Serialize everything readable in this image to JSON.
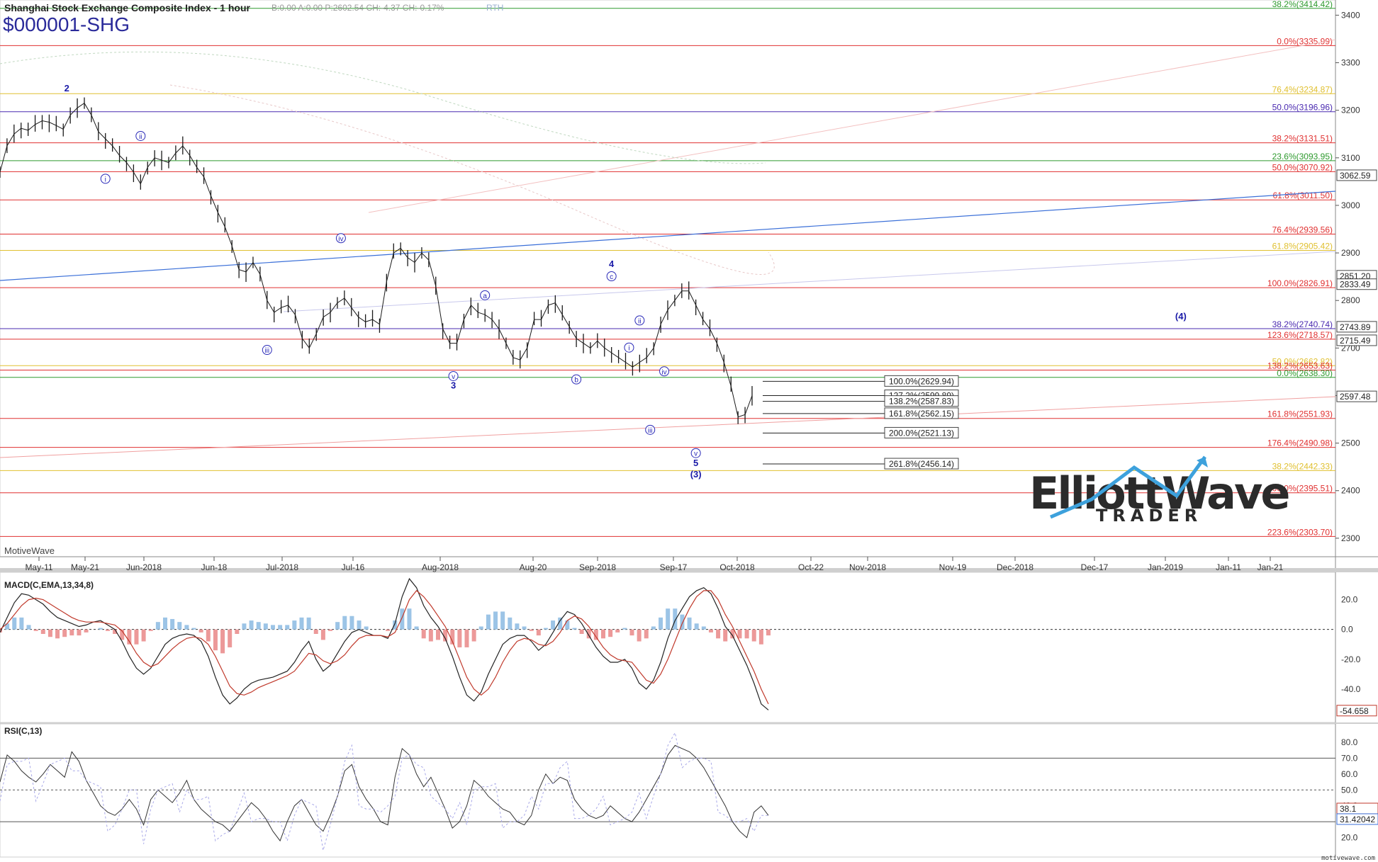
{
  "header": {
    "title": "Shanghai Stock Exchange Composite Index - 1 hour",
    "quote": "B:0.00  A:0.00  P:2602.54  CH:-4.37  CH:-0.17%",
    "rth": "RTH",
    "symbol": "$000001-SHG"
  },
  "watermark": "MotiveWave",
  "footer_brand": "motivewave.com",
  "logo": {
    "line1": "ElliottWave",
    "line2": "TRADER"
  },
  "chart_data": [
    {
      "type": "line",
      "panel": "price",
      "title": "Shanghai Stock Exchange Composite Index - 1 hour",
      "ylim": [
        2270,
        3420
      ],
      "yticks": [
        2300,
        2400,
        2500,
        2600,
        2700,
        2800,
        2900,
        3000,
        3100,
        3200,
        3300,
        3400
      ],
      "xlabels": [
        "May-11",
        "May-21",
        "Jun-2018",
        "Jun-18",
        "Jul-2018",
        "Jul-16",
        "Aug-2018",
        "Aug-20",
        "Sep-2018",
        "Sep-17",
        "Oct-2018",
        "Oct-22",
        "Nov-2018",
        "Nov-19",
        "Dec-2018",
        "Dec-17",
        "Jan-2019",
        "Jan-11",
        "Jan-21"
      ],
      "x": [
        0,
        5,
        10,
        15,
        20,
        25,
        30,
        35,
        40,
        45,
        50,
        55,
        60,
        65,
        70,
        75,
        80,
        85,
        90,
        95,
        100,
        105,
        110,
        115,
        120,
        125,
        130,
        135,
        140,
        145,
        150,
        155,
        160,
        165,
        170,
        175,
        180,
        185,
        190,
        195,
        200,
        205,
        210,
        215,
        220,
        225,
        230,
        235,
        240,
        245,
        250,
        255,
        260,
        265,
        270,
        275,
        280,
        285,
        290,
        295,
        300,
        305,
        310,
        315,
        320,
        325,
        330,
        335,
        340,
        345,
        350,
        355,
        360,
        365,
        370,
        375,
        380,
        385,
        390,
        395,
        400,
        405,
        410,
        415,
        420,
        425,
        430,
        435,
        440,
        445,
        450,
        455,
        460,
        465,
        470,
        475,
        480,
        485,
        490,
        495,
        500,
        505,
        510,
        515,
        520,
        525,
        530,
        535
      ],
      "series": [
        {
          "values": [
            3070,
            3125,
            3150,
            3162,
            3158,
            3170,
            3178,
            3175,
            3168,
            3160,
            3190,
            3205,
            3215,
            3190,
            3155,
            3140,
            3125,
            3105,
            3090,
            3070,
            3045,
            3080,
            3100,
            3095,
            3090,
            3110,
            3125,
            3105,
            3080,
            3060,
            3020,
            2985,
            2955,
            2915,
            2865,
            2860,
            2880,
            2855,
            2800,
            2775,
            2785,
            2790,
            2770,
            2720,
            2700,
            2730,
            2765,
            2775,
            2795,
            2805,
            2785,
            2765,
            2755,
            2760,
            2750,
            2840,
            2900,
            2910,
            2890,
            2880,
            2900,
            2885,
            2830,
            2740,
            2710,
            2710,
            2760,
            2790,
            2775,
            2770,
            2760,
            2740,
            2710,
            2680,
            2675,
            2700,
            2760,
            2760,
            2790,
            2795,
            2770,
            2745,
            2720,
            2710,
            2700,
            2715,
            2700,
            2690,
            2680,
            2670,
            2660,
            2670,
            2680,
            2700,
            2750,
            2780,
            2800,
            2820,
            2820,
            2790,
            2760,
            2740,
            2710,
            2670,
            2620,
            2555,
            2560,
            2600
          ]
        }
      ],
      "fib_levels": [
        {
          "label": "38.2%(3414.42)",
          "value": 3414.42,
          "color": "#2e9a2e"
        },
        {
          "label": "0.0%(3335.99)",
          "value": 3335.99,
          "color": "#e03030"
        },
        {
          "label": "76.4%(3234.87)",
          "value": 3234.87,
          "color": "#e0c030"
        },
        {
          "label": "50.0%(3196.96)",
          "value": 3196.96,
          "color": "#4a2ab0"
        },
        {
          "label": "38.2%(3131.51)",
          "value": 3131.51,
          "color": "#e03030"
        },
        {
          "label": "23.6%(3093.95)",
          "value": 3093.95,
          "color": "#2e9a2e"
        },
        {
          "label": "50.0%(3070.92)",
          "value": 3070.92,
          "color": "#e03030"
        },
        {
          "label": "61.8%(3011.50)",
          "value": 3011.5,
          "color": "#e03030"
        },
        {
          "label": "76.4%(2939.56)",
          "value": 2939.56,
          "color": "#e03030"
        },
        {
          "label": "61.8%(2905.42)",
          "value": 2905.42,
          "color": "#e0c030"
        },
        {
          "label": "100.0%(2826.91)",
          "value": 2826.91,
          "color": "#e03030"
        },
        {
          "label": "38.2%(2740.74)",
          "value": 2740.74,
          "color": "#4a2ab0"
        },
        {
          "label": "123.6%(2718.57)",
          "value": 2718.57,
          "color": "#e03030"
        },
        {
          "label": "50.0%(2662.82)",
          "value": 2662.82,
          "color": "#e0c030"
        },
        {
          "label": "138.2%(2653.63)",
          "value": 2653.63,
          "color": "#e03030"
        },
        {
          "label": "0.0%(2638.30)",
          "value": 2638.3,
          "color": "#2e9a2e"
        },
        {
          "label": "161.8%(2551.93)",
          "value": 2551.93,
          "color": "#e03030"
        },
        {
          "label": "176.4%(2490.98)",
          "value": 2490.98,
          "color": "#e03030"
        },
        {
          "label": "38.2%(2442.33)",
          "value": 2442.33,
          "color": "#e0c030"
        },
        {
          "label": "200.0%(2395.51)",
          "value": 2395.51,
          "color": "#e03030"
        },
        {
          "label": "223.6%(2303.70)",
          "value": 2303.7,
          "color": "#e03030"
        }
      ],
      "ext_levels": [
        {
          "label": "100.0%(2629.94)",
          "value": 2629.94
        },
        {
          "label": "127.2%(2599.89)",
          "value": 2599.89
        },
        {
          "label": "138.2%(2587.83)",
          "value": 2587.83
        },
        {
          "label": "161.8%(2562.15)",
          "value": 2562.15
        },
        {
          "label": "200.0%(2521.13)",
          "value": 2521.13
        },
        {
          "label": "261.8%(2456.14)",
          "value": 2456.14
        }
      ],
      "price_tags": [
        {
          "label": "3062.59",
          "value": 3062.59
        },
        {
          "label": "2851.20",
          "value": 2851.2
        },
        {
          "label": "2833.49",
          "value": 2833.49
        },
        {
          "label": "2743.89",
          "value": 2743.89
        },
        {
          "label": "2715.49",
          "value": 2715.49
        },
        {
          "label": "2597.48",
          "value": 2597.48
        }
      ],
      "wave_labels": [
        {
          "text": "2",
          "x": 19,
          "value": 3240,
          "circled": false,
          "bold": true
        },
        {
          "text": "i",
          "x": 30,
          "value": 3050,
          "circled": true
        },
        {
          "text": "ii",
          "x": 40,
          "value": 3140,
          "circled": true
        },
        {
          "text": "iii",
          "x": 76,
          "value": 2690,
          "circled": true
        },
        {
          "text": "iv",
          "x": 97,
          "value": 2925,
          "circled": true
        },
        {
          "text": "a",
          "x": 138,
          "value": 2805,
          "circled": true
        },
        {
          "text": "v",
          "x": 129,
          "value": 2635,
          "circled": true
        },
        {
          "text": "3",
          "x": 129,
          "value": 2615,
          "circled": false,
          "bold": true
        },
        {
          "text": "b",
          "x": 164,
          "value": 2628,
          "circled": true
        },
        {
          "text": "c",
          "x": 174,
          "value": 2845,
          "circled": true
        },
        {
          "text": "4",
          "x": 174,
          "value": 2870,
          "circled": false,
          "bold": true
        },
        {
          "text": "ii",
          "x": 182,
          "value": 2752,
          "circled": true
        },
        {
          "text": "i",
          "x": 179,
          "value": 2695,
          "circled": true
        },
        {
          "text": "iv",
          "x": 189,
          "value": 2645,
          "circled": true
        },
        {
          "text": "iii",
          "x": 185,
          "value": 2522,
          "circled": true
        },
        {
          "text": "v",
          "x": 198,
          "value": 2473,
          "circled": true
        },
        {
          "text": "5",
          "x": 198,
          "value": 2452,
          "circled": false,
          "bold": true
        },
        {
          "text": "(3)",
          "x": 198,
          "value": 2428,
          "circled": false,
          "bold": true
        },
        {
          "text": "(4)",
          "x": 336,
          "value": 2760,
          "circled": false,
          "bold": true
        }
      ]
    },
    {
      "type": "line",
      "panel": "macd",
      "title": "MACD(C,EMA,13,34,8)",
      "ylim": [
        -60,
        35
      ],
      "yticks": [
        20,
        0,
        -20,
        -40
      ],
      "tick_labels": [
        "20.0",
        "0.0",
        "-20.0",
        "-40.0"
      ],
      "last_value_label": "-54.658",
      "series": [
        {
          "name": "MACD",
          "values": [
            -2,
            8,
            18,
            24,
            23,
            20,
            17,
            12,
            8,
            6,
            4,
            2,
            3,
            5,
            6,
            3,
            0,
            -8,
            -18,
            -26,
            -30,
            -26,
            -18,
            -10,
            -6,
            -4,
            -3,
            -4,
            -8,
            -18,
            -32,
            -44,
            -50,
            -46,
            -40,
            -36,
            -34,
            -33,
            -32,
            -30,
            -28,
            -22,
            -14,
            -8,
            -20,
            -28,
            -24,
            -16,
            -8,
            -2,
            0,
            -2,
            -4,
            -4,
            -6,
            4,
            22,
            34,
            28,
            16,
            8,
            2,
            -6,
            -18,
            -32,
            -44,
            -48,
            -42,
            -30,
            -20,
            -10,
            -6,
            -4,
            -4,
            -8,
            -14,
            -10,
            -2,
            6,
            12,
            10,
            4,
            -4,
            -12,
            -18,
            -22,
            -22,
            -20,
            -26,
            -36,
            -40,
            -34,
            -22,
            -6,
            6,
            14,
            22,
            26,
            28,
            24,
            14,
            2,
            -4,
            -14,
            -24,
            -36,
            -50,
            -54
          ]
        },
        {
          "name": "Signal",
          "values": [
            0,
            4,
            10,
            16,
            20,
            21,
            20,
            17,
            14,
            11,
            8,
            6,
            5,
            5,
            5,
            4,
            3,
            -1,
            -8,
            -16,
            -22,
            -25,
            -23,
            -18,
            -13,
            -9,
            -6,
            -5,
            -6,
            -10,
            -18,
            -28,
            -38,
            -43,
            -44,
            -42,
            -39,
            -37,
            -35,
            -33,
            -31,
            -28,
            -22,
            -16,
            -17,
            -21,
            -23,
            -21,
            -17,
            -11,
            -6,
            -4,
            -4,
            -4,
            -5,
            -2,
            8,
            20,
            26,
            22,
            16,
            9,
            2,
            -8,
            -20,
            -32,
            -40,
            -44,
            -40,
            -32,
            -22,
            -14,
            -8,
            -6,
            -7,
            -10,
            -11,
            -8,
            -2,
            6,
            9,
            7,
            2,
            -5,
            -12,
            -17,
            -20,
            -21,
            -22,
            -28,
            -34,
            -36,
            -30,
            -20,
            -8,
            4,
            14,
            22,
            26,
            26,
            20,
            10,
            2,
            -8,
            -18,
            -28,
            -40,
            -50
          ]
        }
      ]
    },
    {
      "type": "line",
      "panel": "rsi",
      "title": "RSI(C,13)",
      "ylim": [
        10,
        88
      ],
      "yticks": [
        80,
        70,
        60,
        50,
        40,
        30,
        20
      ],
      "tick_labels": [
        "80.0",
        "70.0",
        "60.0",
        "50.0",
        "40.0",
        "30.0",
        "20.0"
      ],
      "levels": [
        70,
        50,
        30
      ],
      "last_value_labels": [
        "38.1",
        "31.42042"
      ],
      "series": [
        {
          "name": "RSI",
          "values": [
            55,
            72,
            68,
            62,
            58,
            55,
            60,
            66,
            62,
            58,
            74,
            68,
            56,
            48,
            40,
            36,
            34,
            38,
            44,
            38,
            28,
            44,
            50,
            46,
            42,
            48,
            56,
            44,
            38,
            34,
            30,
            28,
            24,
            30,
            36,
            42,
            38,
            32,
            24,
            18,
            30,
            40,
            44,
            36,
            28,
            24,
            34,
            46,
            62,
            66,
            52,
            44,
            38,
            30,
            28,
            58,
            76,
            72,
            60,
            52,
            58,
            48,
            38,
            26,
            30,
            40,
            56,
            52,
            46,
            42,
            38,
            36,
            30,
            28,
            34,
            50,
            60,
            54,
            58,
            56,
            44,
            38,
            34,
            32,
            34,
            40,
            36,
            32,
            30,
            36,
            44,
            52,
            60,
            72,
            78,
            76,
            74,
            70,
            64,
            56,
            48,
            40,
            30,
            24,
            20,
            36,
            40,
            34
          ]
        }
      ]
    }
  ]
}
